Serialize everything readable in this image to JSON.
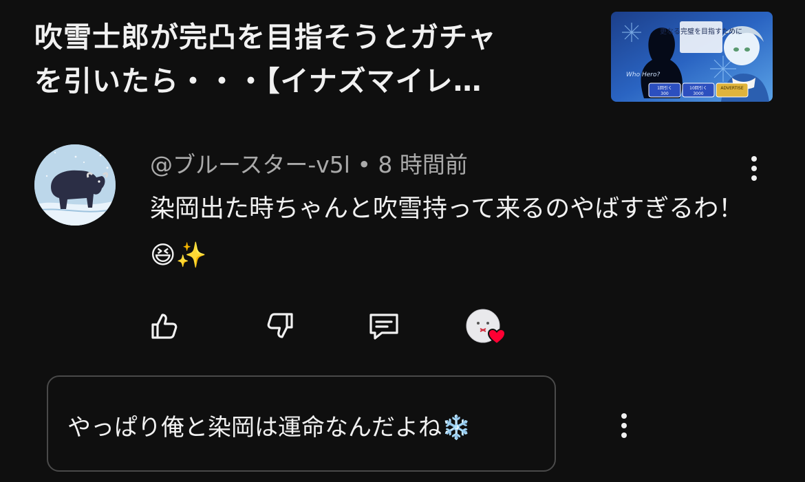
{
  "video": {
    "title_line1": "吹雪士郎が完凸を目指そうとガチャ",
    "title_line2": "を引いたら・・・【イナズマイレ…",
    "thumbnail": {
      "caption_right": "更なる完璧を目指すために",
      "caption_left": "Who Hero?",
      "buttons": [
        "1回引く",
        "10回引く",
        "ADVERTISE"
      ],
      "costs": [
        "300",
        "3000",
        ""
      ]
    }
  },
  "comment": {
    "author": "@ブルースター-v5l",
    "separator": "•",
    "time": "8 時間前",
    "text": "染岡出た時ちゃんと吹雪持って来るのやばすぎるわ！😆✨",
    "avatar_icon": "musk-ox-avatar"
  },
  "actions": {
    "like_icon": "thumbs-up-icon",
    "dislike_icon": "thumbs-down-icon",
    "reply_icon": "comment-icon",
    "creator_heart_icon": "creator-heart-icon"
  },
  "reply": {
    "text": "やっぱり俺と染岡は運命なんだよね❄️"
  },
  "colors": {
    "background": "#0f0f0f",
    "text": "#f1f1f1",
    "secondary_text": "#aaaaaa",
    "heart": "#ff0033"
  }
}
